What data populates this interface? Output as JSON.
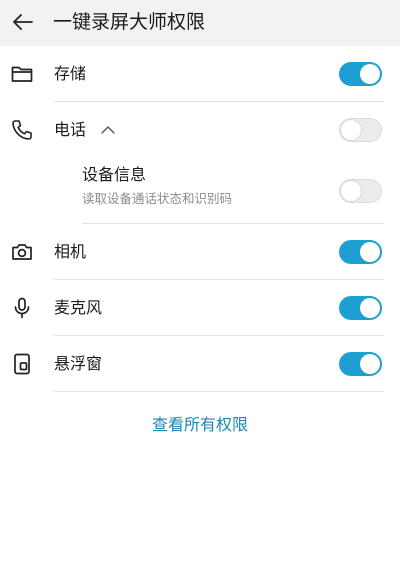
{
  "header": {
    "back_icon": "arrow-left-icon",
    "title": "一键录屏大师权限"
  },
  "permissions": [
    {
      "label": "存储",
      "icon": "folder-icon",
      "enabled": true
    },
    {
      "label": "电话",
      "icon": "phone-icon",
      "enabled": false,
      "expanded": true,
      "children": [
        {
          "label": "设备信息",
          "description": "读取设备通话状态和识别码",
          "enabled": false
        }
      ]
    },
    {
      "label": "相机",
      "icon": "camera-icon",
      "enabled": true
    },
    {
      "label": "麦克风",
      "icon": "microphone-icon",
      "enabled": true
    },
    {
      "label": "悬浮窗",
      "icon": "floating-window-icon",
      "enabled": true
    }
  ],
  "footer": {
    "view_all_label": "查看所有权限"
  },
  "colors": {
    "accent": "#1e9fd4",
    "link": "#1b87b5",
    "header_bg": "#f2f2f2",
    "toggle_off": "#ececec"
  }
}
